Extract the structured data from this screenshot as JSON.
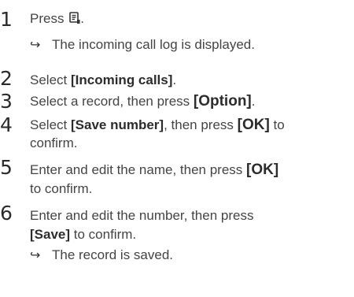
{
  "steps": [
    {
      "number": "1",
      "lines": [
        {
          "parts": [
            "Press "
          ],
          "icon": "phonebook-icon",
          "after": "."
        }
      ],
      "result": {
        "arrow": "↪",
        "text": "The incoming call log is displayed."
      }
    },
    {
      "number": "2",
      "line1": {
        "t1": "Select ",
        "b1": "[Incoming calls]",
        "t2": "."
      }
    },
    {
      "number": "3",
      "line1": {
        "t1": "Select a record, then press ",
        "b1": "[Option]",
        "t2": "."
      }
    },
    {
      "number": "4",
      "line1": {
        "t1": "Select ",
        "b1": "[Save number]",
        "t2": ", then press ",
        "b2": "[OK]",
        "t3": " to"
      },
      "line2": "confirm."
    },
    {
      "number": "5",
      "line1": {
        "t1": "Enter and edit the name, then press ",
        "b1": "[OK]"
      },
      "line2": "to confirm."
    },
    {
      "number": "6",
      "line1": "Enter and edit the number, then press",
      "line2": {
        "b1": "[Save]",
        "t1": " to confirm."
      },
      "result": {
        "arrow": "↪",
        "text": "The record is saved."
      }
    }
  ],
  "step1_text": "Press ",
  "step1_after": ".",
  "icon_name": "phonebook-icon"
}
